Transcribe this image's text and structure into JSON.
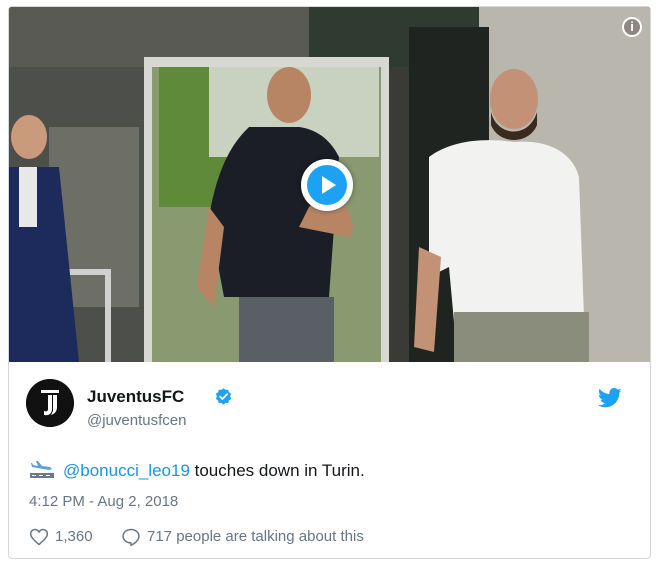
{
  "tweet": {
    "display_name": "JuventusFC",
    "handle": "@juventusfcen",
    "mention": "@bonucci_leo19",
    "text_rest": " touches down in Turin.",
    "timestamp": "4:12 PM - Aug 2, 2018",
    "likes": "1,360",
    "talking": "717 people are talking about this"
  },
  "icons": {
    "info": "info-icon",
    "play": "play-icon",
    "verified": "verified-badge-icon",
    "bird": "twitter-bird-icon",
    "like": "heart-icon",
    "reply": "speech-bubble-icon",
    "emoji": "airplane-landing-emoji"
  },
  "colors": {
    "accent": "#1da1f2",
    "link": "#1b95e0",
    "muted": "#657786"
  },
  "labels": {
    "info_glyph": "i"
  }
}
